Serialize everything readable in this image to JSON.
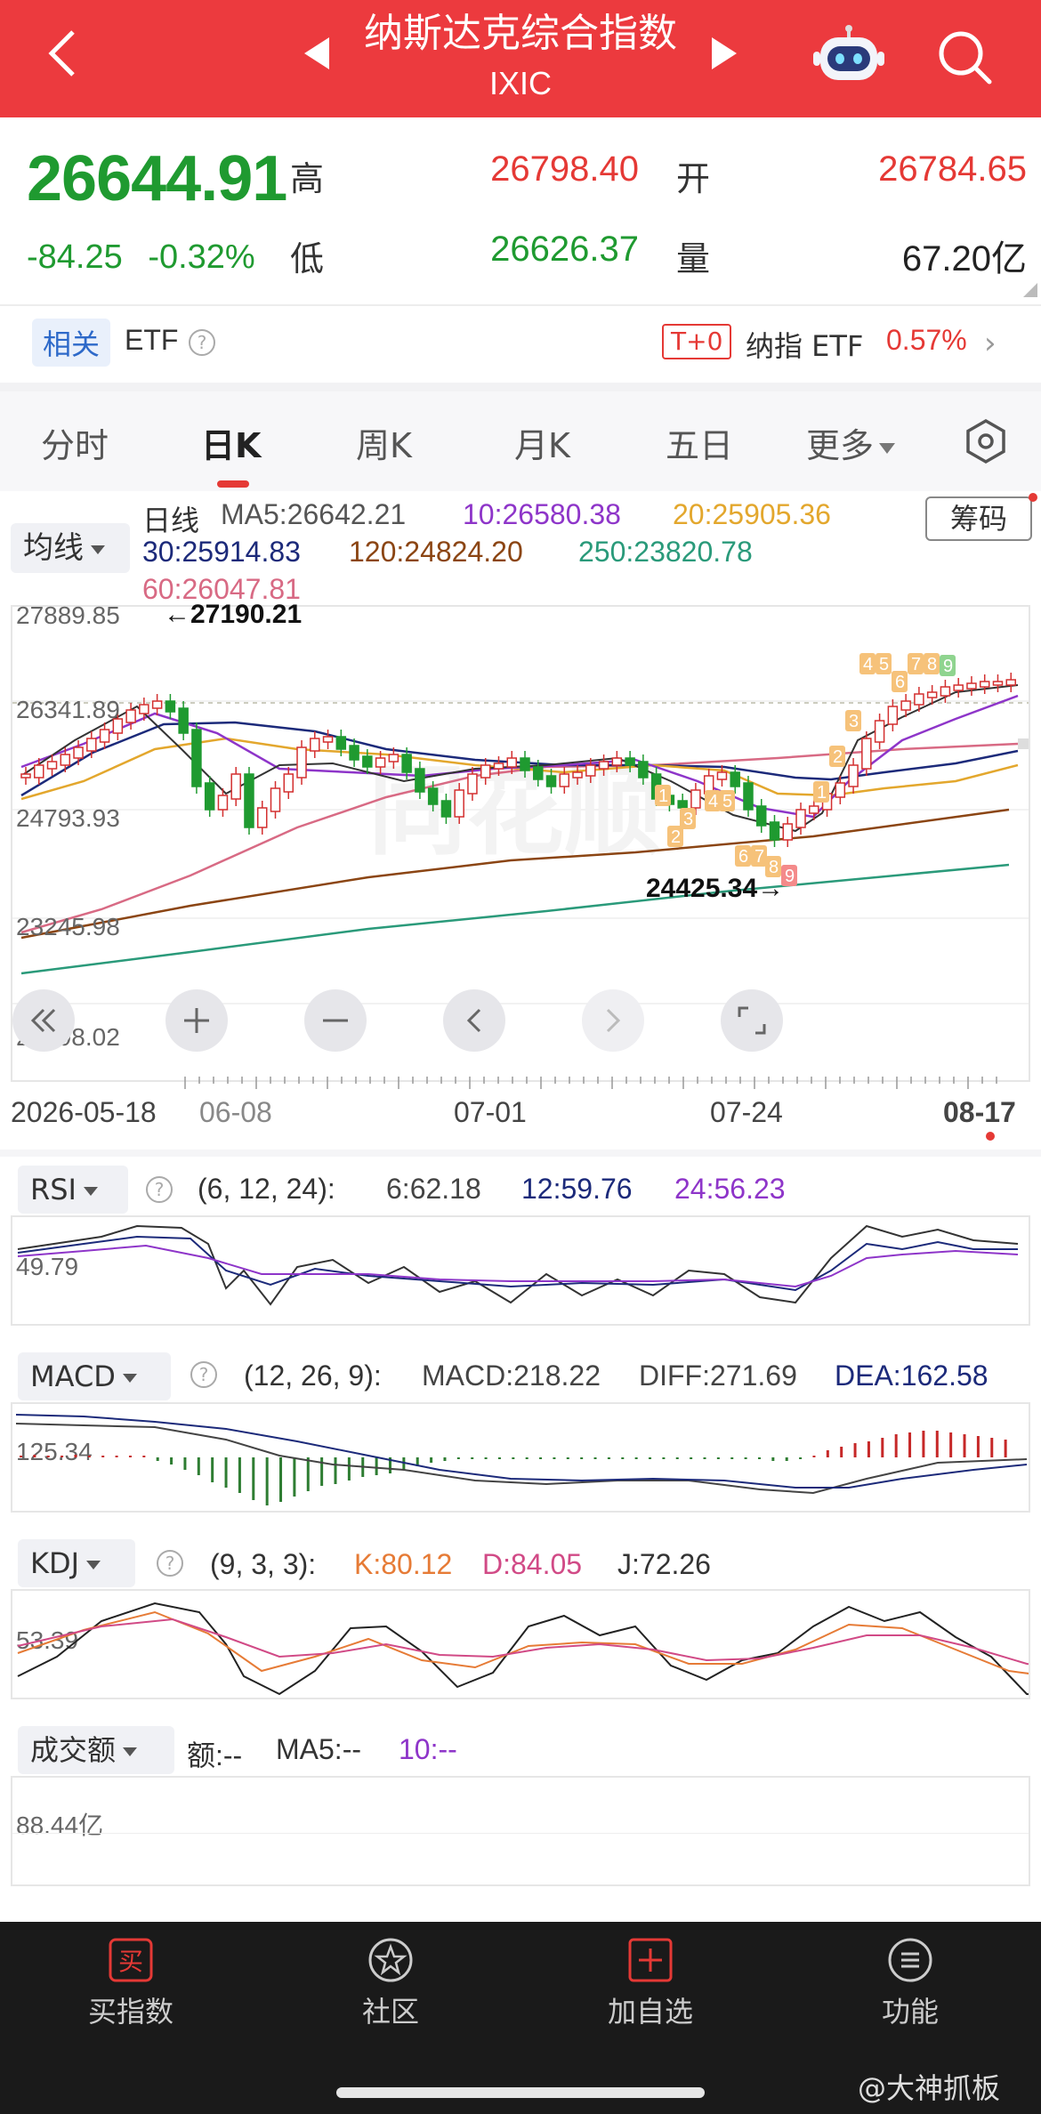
{
  "header": {
    "title": "纳斯达克综合指数",
    "subtitle": "IXIC"
  },
  "quote": {
    "price": "26644.91",
    "change": "-84.25",
    "change_pct": "-0.32%",
    "high_label": "高",
    "high_value": "26798.40",
    "open_label": "开",
    "open_value": "26784.65",
    "low_label": "低",
    "low_value": "26626.37",
    "volume_label": "量",
    "volume_value": "67.20亿"
  },
  "etf": {
    "related_tag": "相关",
    "label": "ETF",
    "t0_tag": "T+0",
    "name": "纳指 ETF",
    "pct": "0.57%"
  },
  "tabs": [
    "分时",
    "日K",
    "周K",
    "月K",
    "五日",
    "更多"
  ],
  "active_tab": "日K",
  "ma": {
    "selector": "均线",
    "daily": "日线",
    "ma5": "MA5:26642.21",
    "ma10": "10:26580.38",
    "ma20": "20:25905.36",
    "ma30": "30:25914.83",
    "ma120": "120:24824.20",
    "ma250": "250:23820.78",
    "ma60": "60:26047.81",
    "chip_button": "筹码"
  },
  "price_axis": [
    "27889.85",
    "26341.89",
    "24793.93",
    "23245.98",
    "21698.02"
  ],
  "annotations": {
    "high_marker": "←27190.21",
    "low_marker": "24425.34→"
  },
  "dates": [
    "2026-05-18",
    "06-08",
    "07-01",
    "07-24",
    "08-17"
  ],
  "rsi": {
    "name": "RSI",
    "params": "(6, 12, 24):",
    "v6": "6:62.18",
    "v12": "12:59.76",
    "v24": "24:56.23",
    "axis": "49.79"
  },
  "macd": {
    "name": "MACD",
    "params": "(12, 26, 9):",
    "macd": "MACD:218.22",
    "diff": "DIFF:271.69",
    "dea": "DEA:162.58",
    "axis": "125.34"
  },
  "kdj": {
    "name": "KDJ",
    "params": "(9, 3, 3):",
    "k": "K:80.12",
    "d": "D:84.05",
    "j": "J:72.26",
    "axis": "53.39"
  },
  "turnover": {
    "name": "成交额",
    "amount": "额:--",
    "ma5": "MA5:--",
    "ma10": "10:--",
    "axis": "88.44亿"
  },
  "bottom_nav": [
    "买指数",
    "社区",
    "加自选",
    "功能"
  ],
  "watermark": "@大神抓板",
  "colors": {
    "header_red": "#ec3a3e",
    "up_red": "#e53935",
    "down_green": "#1f9a30"
  }
}
